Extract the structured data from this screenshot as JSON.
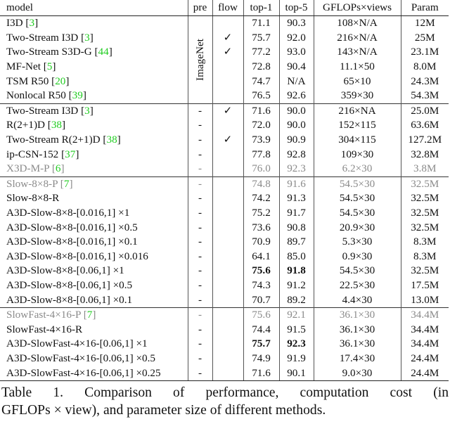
{
  "table": {
    "headers": [
      "model",
      "pre",
      "flow",
      "top-1",
      "top-5",
      "GFLOPs×views",
      "Param"
    ],
    "groups": [
      {
        "pretrain_label": "ImageNet",
        "rows": [
          {
            "model": "I3D",
            "cite": "3",
            "flow": "",
            "top1": "71.1",
            "top5": "90.3",
            "gflops": "108×N/A",
            "param": "12M"
          },
          {
            "model": "Two-Stream I3D",
            "cite": "3",
            "flow": "✓",
            "top1": "75.7",
            "top5": "92.0",
            "gflops": "216×N/A",
            "param": "25M"
          },
          {
            "model": "Two-Stream S3D-G",
            "cite": "44",
            "flow": "✓",
            "top1": "77.2",
            "top5": "93.0",
            "gflops": "143×N/A",
            "param": "23.1M"
          },
          {
            "model": "MF-Net",
            "cite": "5",
            "flow": "",
            "top1": "72.8",
            "top5": "90.4",
            "gflops": "11.1×50",
            "param": "8.0M"
          },
          {
            "model": "TSM R50",
            "cite": "20",
            "flow": "",
            "top1": "74.7",
            "top5": "N/A",
            "gflops": "65×10",
            "param": "24.3M"
          },
          {
            "model": "Nonlocal R50",
            "cite": "39",
            "flow": "",
            "top1": "76.5",
            "top5": "92.6",
            "gflops": "359×30",
            "param": "54.3M"
          }
        ]
      },
      {
        "rows": [
          {
            "model": "Two-Stream I3D",
            "cite": "3",
            "pre": "-",
            "flow": "✓",
            "top1": "71.6",
            "top5": "90.0",
            "gflops": "216×NA",
            "param": "25.0M"
          },
          {
            "model": "R(2+1)D",
            "cite": "38",
            "pre": "-",
            "flow": "",
            "top1": "72.0",
            "top5": "90.0",
            "gflops": "152×115",
            "param": "63.6M"
          },
          {
            "model": "Two-Stream R(2+1)D",
            "cite": "38",
            "pre": "-",
            "flow": "✓",
            "top1": "73.9",
            "top5": "90.9",
            "gflops": "304×115",
            "param": "127.2M"
          },
          {
            "model": "ip-CSN-152",
            "cite": "37",
            "pre": "-",
            "flow": "",
            "top1": "77.8",
            "top5": "92.8",
            "gflops": "109×30",
            "param": "32.8M"
          },
          {
            "model": "X3D-M-P",
            "cite": "6",
            "pre": "-",
            "flow": "",
            "top1": "76.0",
            "top5": "92.3",
            "gflops": "6.2×30",
            "param": "3.8M",
            "gray": true
          }
        ]
      },
      {
        "rows": [
          {
            "model": "Slow-8×8-P",
            "cite": "7",
            "pre": "-",
            "flow": "",
            "top1": "74.8",
            "top5": "91.6",
            "gflops": "54.5×30",
            "param": "32.5M",
            "gray": true
          },
          {
            "model": "Slow-8×8-R",
            "pre": "-",
            "flow": "",
            "top1": "74.2",
            "top5": "91.3",
            "gflops": "54.5×30",
            "param": "32.5M"
          },
          {
            "model": "A3D-Slow-8×8-[0.016,1] ×1",
            "pre": "-",
            "flow": "",
            "top1": "75.2",
            "top5": "91.7",
            "gflops": "54.5×30",
            "param": "32.5M"
          },
          {
            "model": "A3D-Slow-8×8-[0.016,1] ×0.5",
            "pre": "-",
            "flow": "",
            "top1": "73.6",
            "top5": "90.8",
            "gflops": "20.9×30",
            "param": "32.5M"
          },
          {
            "model": "A3D-Slow-8×8-[0.016,1] ×0.1",
            "pre": "-",
            "flow": "",
            "top1": "70.9",
            "top5": "89.7",
            "gflops": "5.3×30",
            "param": "8.3M"
          },
          {
            "model": "A3D-Slow-8×8-[0.016,1] ×0.016",
            "pre": "-",
            "flow": "",
            "top1": "64.1",
            "top5": "85.0",
            "gflops": "0.9×30",
            "param": "8.3M"
          },
          {
            "model": "A3D-Slow-8×8-[0.06,1] ×1",
            "pre": "-",
            "flow": "",
            "top1": "75.6",
            "top5": "91.8",
            "gflops": "54.5×30",
            "param": "32.5M",
            "bold_top": true
          },
          {
            "model": "A3D-Slow-8×8-[0.06,1] ×0.5",
            "pre": "-",
            "flow": "",
            "top1": "74.3",
            "top5": "91.2",
            "gflops": "22.5×30",
            "param": "17.5M"
          },
          {
            "model": "A3D-Slow-8×8-[0.06,1] ×0.1",
            "pre": "-",
            "flow": "",
            "top1": "70.7",
            "top5": "89.2",
            "gflops": "4.4×30",
            "param": "13.0M"
          }
        ]
      },
      {
        "rows": [
          {
            "model": "SlowFast-4×16-P",
            "cite": "7",
            "pre": "-",
            "flow": "",
            "top1": "75.6",
            "top5": "92.1",
            "gflops": "36.1×30",
            "param": "34.4M",
            "gray": true
          },
          {
            "model": "SlowFast-4×16-R",
            "pre": "-",
            "flow": "",
            "top1": "74.4",
            "top5": "91.5",
            "gflops": "36.1×30",
            "param": "34.4M"
          },
          {
            "model": "A3D-SlowFast-4×16-[0.06,1] ×1",
            "pre": "-",
            "flow": "",
            "top1": "75.7",
            "top5": "92.3",
            "gflops": "36.1×30",
            "param": "34.4M",
            "bold_top": true
          },
          {
            "model": "A3D-SlowFast-4×16-[0.06,1] ×0.5",
            "pre": "-",
            "flow": "",
            "top1": "74.9",
            "top5": "91.9",
            "gflops": "17.4×30",
            "param": "24.4M"
          },
          {
            "model": "A3D-SlowFast-4×16-[0.06,1] ×0.25",
            "pre": "-",
            "flow": "",
            "top1": "71.6",
            "top5": "90.1",
            "gflops": "9.0×30",
            "param": "24.4M"
          }
        ]
      }
    ]
  },
  "caption": {
    "line1": "Table 1. Comparison of performance, computation cost (in",
    "line2": "GFLOPs × view), and parameter size of different methods."
  }
}
